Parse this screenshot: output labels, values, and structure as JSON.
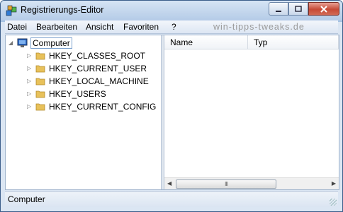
{
  "window": {
    "title": "Registrierungs-Editor",
    "buttons": [
      "minimize",
      "maximize",
      "close"
    ]
  },
  "menubar": {
    "items": [
      "Datei",
      "Bearbeiten",
      "Ansicht",
      "Favoriten",
      "?"
    ],
    "watermark": "win-tipps-tweaks.de"
  },
  "tree": {
    "root": "Computer",
    "hives": [
      "HKEY_CLASSES_ROOT",
      "HKEY_CURRENT_USER",
      "HKEY_LOCAL_MACHINE",
      "HKEY_USERS",
      "HKEY_CURRENT_CONFIG"
    ]
  },
  "list": {
    "columns": [
      "Name",
      "Typ"
    ],
    "scroll_grip": "III"
  },
  "status": {
    "text": "Computer"
  },
  "colors": {
    "folder": "#e8c15a",
    "selection_border": "#7da2ce",
    "close_button": "#c64a36"
  }
}
